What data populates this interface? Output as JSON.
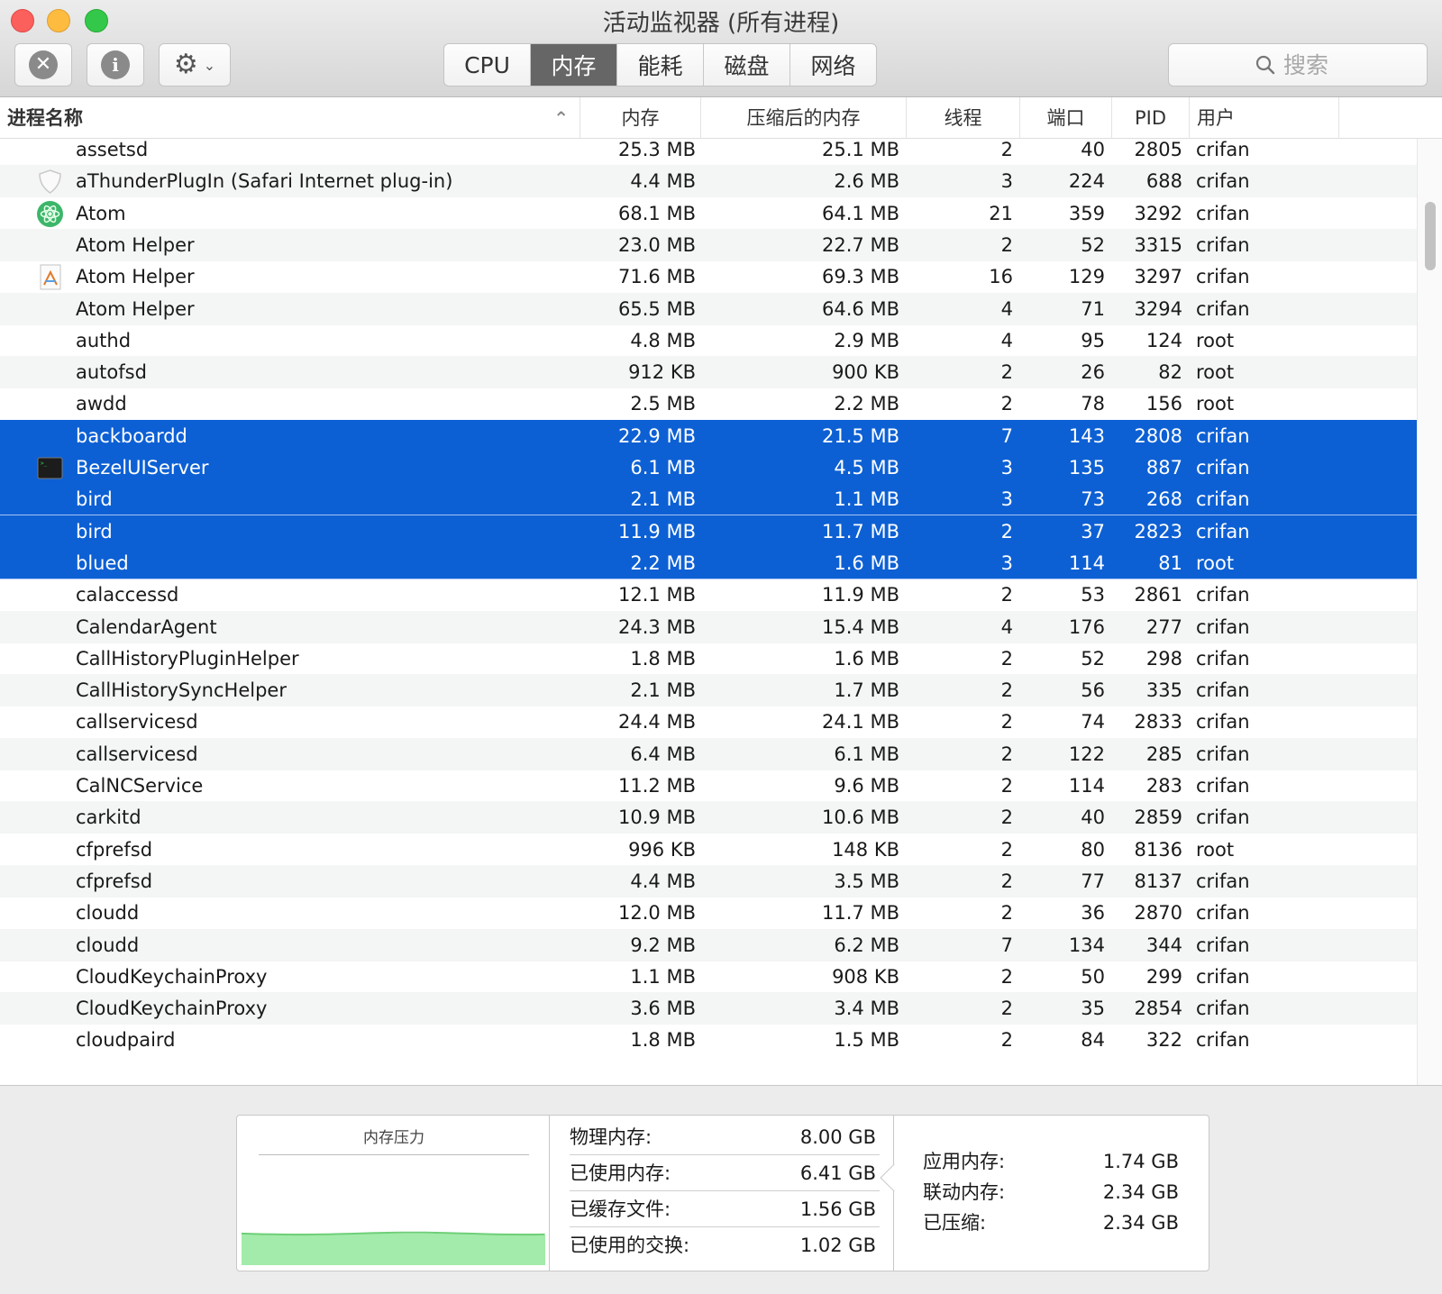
{
  "window": {
    "title": "活动监视器 (所有进程)"
  },
  "tabs": [
    "CPU",
    "内存",
    "能耗",
    "磁盘",
    "网络"
  ],
  "active_tab": "内存",
  "search": {
    "placeholder": "搜索",
    "value": ""
  },
  "columns": [
    "进程名称",
    "内存",
    "压缩后的内存",
    "线程",
    "端口",
    "PID",
    "用户"
  ],
  "rows": [
    {
      "name": "assetsd",
      "mem": "25.3 MB",
      "cmem": "25.1 MB",
      "threads": "2",
      "ports": "40",
      "pid": "2805",
      "user": "crifan",
      "icon": "",
      "selected": false
    },
    {
      "name": "aThunderPlugIn (Safari Internet plug-in)",
      "mem": "4.4 MB",
      "cmem": "2.6 MB",
      "threads": "3",
      "ports": "224",
      "pid": "688",
      "user": "crifan",
      "icon": "shield-icon",
      "selected": false
    },
    {
      "name": "Atom",
      "mem": "68.1 MB",
      "cmem": "64.1 MB",
      "threads": "21",
      "ports": "359",
      "pid": "3292",
      "user": "crifan",
      "icon": "atom-app-icon",
      "selected": false
    },
    {
      "name": "Atom Helper",
      "mem": "23.0 MB",
      "cmem": "22.7 MB",
      "threads": "2",
      "ports": "52",
      "pid": "3315",
      "user": "crifan",
      "icon": "",
      "selected": false
    },
    {
      "name": "Atom Helper",
      "mem": "71.6 MB",
      "cmem": "69.3 MB",
      "threads": "16",
      "ports": "129",
      "pid": "3297",
      "user": "crifan",
      "icon": "document-app-icon",
      "selected": false
    },
    {
      "name": "Atom Helper",
      "mem": "65.5 MB",
      "cmem": "64.6 MB",
      "threads": "4",
      "ports": "71",
      "pid": "3294",
      "user": "crifan",
      "icon": "",
      "selected": false
    },
    {
      "name": "authd",
      "mem": "4.8 MB",
      "cmem": "2.9 MB",
      "threads": "4",
      "ports": "95",
      "pid": "124",
      "user": "root",
      "icon": "",
      "selected": false
    },
    {
      "name": "autofsd",
      "mem": "912 KB",
      "cmem": "900 KB",
      "threads": "2",
      "ports": "26",
      "pid": "82",
      "user": "root",
      "icon": "",
      "selected": false
    },
    {
      "name": "awdd",
      "mem": "2.5 MB",
      "cmem": "2.2 MB",
      "threads": "2",
      "ports": "78",
      "pid": "156",
      "user": "root",
      "icon": "",
      "selected": false
    },
    {
      "name": "backboardd",
      "mem": "22.9 MB",
      "cmem": "21.5 MB",
      "threads": "7",
      "ports": "143",
      "pid": "2808",
      "user": "crifan",
      "icon": "",
      "selected": true
    },
    {
      "name": "BezelUIServer",
      "mem": "6.1 MB",
      "cmem": "4.5 MB",
      "threads": "3",
      "ports": "135",
      "pid": "887",
      "user": "crifan",
      "icon": "terminal-icon",
      "selected": true
    },
    {
      "name": "bird",
      "mem": "2.1 MB",
      "cmem": "1.1 MB",
      "threads": "3",
      "ports": "73",
      "pid": "268",
      "user": "crifan",
      "icon": "",
      "selected": true
    },
    {
      "name": "bird",
      "mem": "11.9 MB",
      "cmem": "11.7 MB",
      "threads": "2",
      "ports": "37",
      "pid": "2823",
      "user": "crifan",
      "icon": "",
      "selected": true
    },
    {
      "name": "blued",
      "mem": "2.2 MB",
      "cmem": "1.6 MB",
      "threads": "3",
      "ports": "114",
      "pid": "81",
      "user": "root",
      "icon": "",
      "selected": true
    },
    {
      "name": "calaccessd",
      "mem": "12.1 MB",
      "cmem": "11.9 MB",
      "threads": "2",
      "ports": "53",
      "pid": "2861",
      "user": "crifan",
      "icon": "",
      "selected": false
    },
    {
      "name": "CalendarAgent",
      "mem": "24.3 MB",
      "cmem": "15.4 MB",
      "threads": "4",
      "ports": "176",
      "pid": "277",
      "user": "crifan",
      "icon": "",
      "selected": false
    },
    {
      "name": "CallHistoryPluginHelper",
      "mem": "1.8 MB",
      "cmem": "1.6 MB",
      "threads": "2",
      "ports": "52",
      "pid": "298",
      "user": "crifan",
      "icon": "",
      "selected": false
    },
    {
      "name": "CallHistorySyncHelper",
      "mem": "2.1 MB",
      "cmem": "1.7 MB",
      "threads": "2",
      "ports": "56",
      "pid": "335",
      "user": "crifan",
      "icon": "",
      "selected": false
    },
    {
      "name": "callservicesd",
      "mem": "24.4 MB",
      "cmem": "24.1 MB",
      "threads": "2",
      "ports": "74",
      "pid": "2833",
      "user": "crifan",
      "icon": "",
      "selected": false
    },
    {
      "name": "callservicesd",
      "mem": "6.4 MB",
      "cmem": "6.1 MB",
      "threads": "2",
      "ports": "122",
      "pid": "285",
      "user": "crifan",
      "icon": "",
      "selected": false
    },
    {
      "name": "CalNCService",
      "mem": "11.2 MB",
      "cmem": "9.6 MB",
      "threads": "2",
      "ports": "114",
      "pid": "283",
      "user": "crifan",
      "icon": "",
      "selected": false
    },
    {
      "name": "carkitd",
      "mem": "10.9 MB",
      "cmem": "10.6 MB",
      "threads": "2",
      "ports": "40",
      "pid": "2859",
      "user": "crifan",
      "icon": "",
      "selected": false
    },
    {
      "name": "cfprefsd",
      "mem": "996 KB",
      "cmem": "148 KB",
      "threads": "2",
      "ports": "80",
      "pid": "8136",
      "user": "root",
      "icon": "",
      "selected": false
    },
    {
      "name": "cfprefsd",
      "mem": "4.4 MB",
      "cmem": "3.5 MB",
      "threads": "2",
      "ports": "77",
      "pid": "8137",
      "user": "crifan",
      "icon": "",
      "selected": false
    },
    {
      "name": "cloudd",
      "mem": "12.0 MB",
      "cmem": "11.7 MB",
      "threads": "2",
      "ports": "36",
      "pid": "2870",
      "user": "crifan",
      "icon": "",
      "selected": false
    },
    {
      "name": "cloudd",
      "mem": "9.2 MB",
      "cmem": "6.2 MB",
      "threads": "7",
      "ports": "134",
      "pid": "344",
      "user": "crifan",
      "icon": "",
      "selected": false
    },
    {
      "name": "CloudKeychainProxy",
      "mem": "1.1 MB",
      "cmem": "908 KB",
      "threads": "2",
      "ports": "50",
      "pid": "299",
      "user": "crifan",
      "icon": "",
      "selected": false
    },
    {
      "name": "CloudKeychainProxy",
      "mem": "3.6 MB",
      "cmem": "3.4 MB",
      "threads": "2",
      "ports": "35",
      "pid": "2854",
      "user": "crifan",
      "icon": "",
      "selected": false
    },
    {
      "name": "cloudpaird",
      "mem": "1.8 MB",
      "cmem": "1.5 MB",
      "threads": "2",
      "ports": "84",
      "pid": "322",
      "user": "crifan",
      "icon": "",
      "selected": false
    }
  ],
  "memory": {
    "pressure_label": "内存压力",
    "pressure_level": 0.45,
    "physical": {
      "label": "物理内存:",
      "value": "8.00 GB"
    },
    "used": {
      "label": "已使用内存:",
      "value": "6.41 GB"
    },
    "cached": {
      "label": "已缓存文件:",
      "value": "1.56 GB"
    },
    "swap": {
      "label": "已使用的交换:",
      "value": "1.02 GB"
    },
    "app": {
      "label": "应用内存:",
      "value": "1.74 GB"
    },
    "wired": {
      "label": "联动内存:",
      "value": "2.34 GB"
    },
    "compressed": {
      "label": "已压缩:",
      "value": "2.34 GB"
    }
  },
  "colors": {
    "selection": "#0d60d4",
    "pressure_fill": "#a3ebaa",
    "pressure_line": "#6fcf79"
  }
}
